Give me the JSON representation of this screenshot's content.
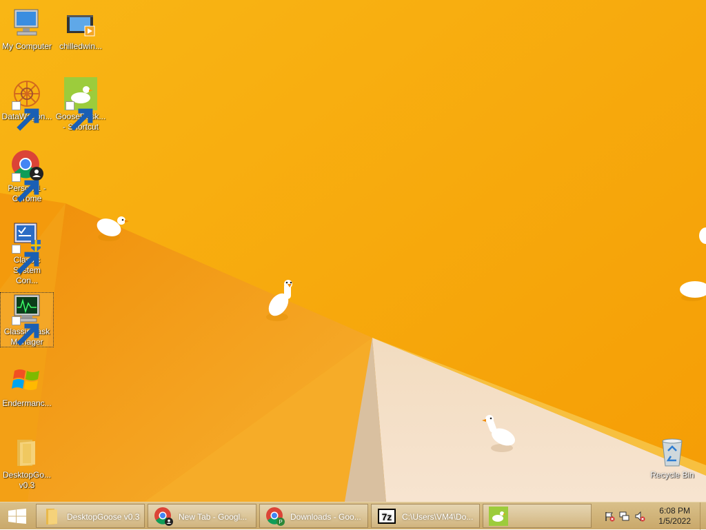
{
  "desktop": {
    "icons": [
      {
        "label": "My Computer"
      },
      {
        "label": "chilledwin..."
      },
      {
        "label": "DataWagon..."
      },
      {
        "label": "GooseDesk... - Shortcut"
      },
      {
        "label": "Person 1 - Chrome"
      },
      {
        "label": "Classic System Con..."
      },
      {
        "label": "Classic Task Manager"
      },
      {
        "label": "Endermanc..."
      },
      {
        "label": "DesktopGo... v0.3"
      },
      {
        "label": "Recycle Bin"
      }
    ]
  },
  "taskbar": {
    "buttons": [
      {
        "label": "DesktopGoose v0.3",
        "icon": "folder-icon"
      },
      {
        "label": "New Tab - Googl...",
        "icon": "chrome-icon"
      },
      {
        "label": "Downloads - Goo...",
        "icon": "chrome-icon"
      },
      {
        "label": "C:\\Users\\VM4\\Do...",
        "icon": "7zip-icon"
      },
      {
        "label": "",
        "icon": "goose-icon"
      }
    ],
    "clock": {
      "time": "6:08 PM",
      "date": "1/5/2022"
    }
  },
  "colors": {
    "wallpaper": "#f7a80a",
    "taskbar": "#d4b87c",
    "accent": "#f08a00"
  }
}
